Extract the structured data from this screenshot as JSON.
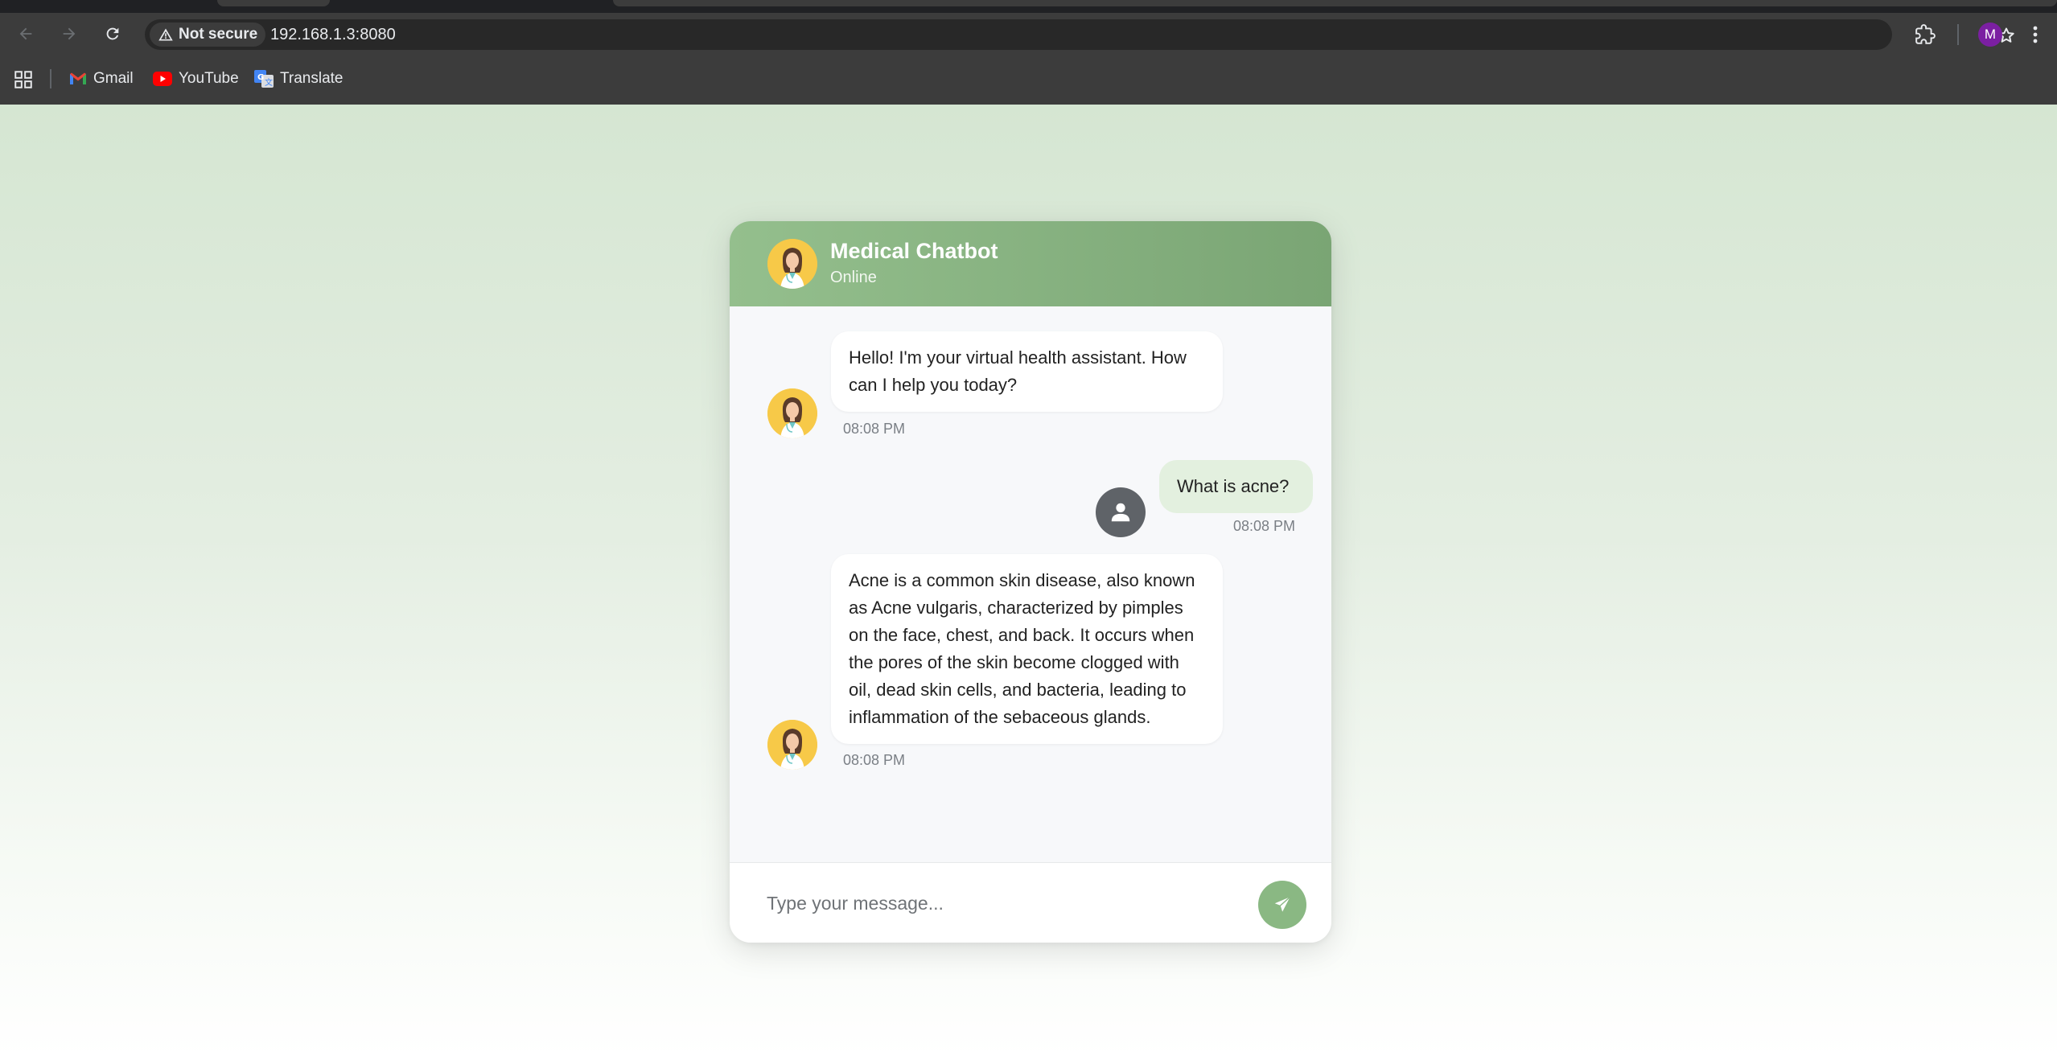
{
  "browser": {
    "security_label": "Not secure",
    "url": "192.168.1.3:8080",
    "profile_initial": "M",
    "bookmarks": [
      {
        "label": "Gmail",
        "icon": "gmail-icon"
      },
      {
        "label": "YouTube",
        "icon": "youtube-icon"
      },
      {
        "label": "Translate",
        "icon": "translate-icon"
      }
    ]
  },
  "chat": {
    "title": "Medical Chatbot",
    "status": "Online",
    "messages": [
      {
        "sender": "bot",
        "text": "Hello! I'm your virtual health assistant. How can I help you today?",
        "time": "08:08 PM"
      },
      {
        "sender": "user",
        "text": "What is acne?",
        "time": "08:08 PM"
      },
      {
        "sender": "bot",
        "text": "Acne is a common skin disease, also known as Acne vulgaris, characterized by pimples on the face, chest, and back. It occurs when the pores of the skin become clogged with oil, dead skin cells, and bacteria, leading to inflammation of the sebaceous glands.",
        "time": "08:08 PM"
      }
    ],
    "input_placeholder": "Type your message..."
  },
  "colors": {
    "header_start": "#94bf8d",
    "header_end": "#7aa574",
    "send_button": "#8ab883",
    "user_bubble": "#e3f0df",
    "avatar_bg": "#f7c948"
  }
}
